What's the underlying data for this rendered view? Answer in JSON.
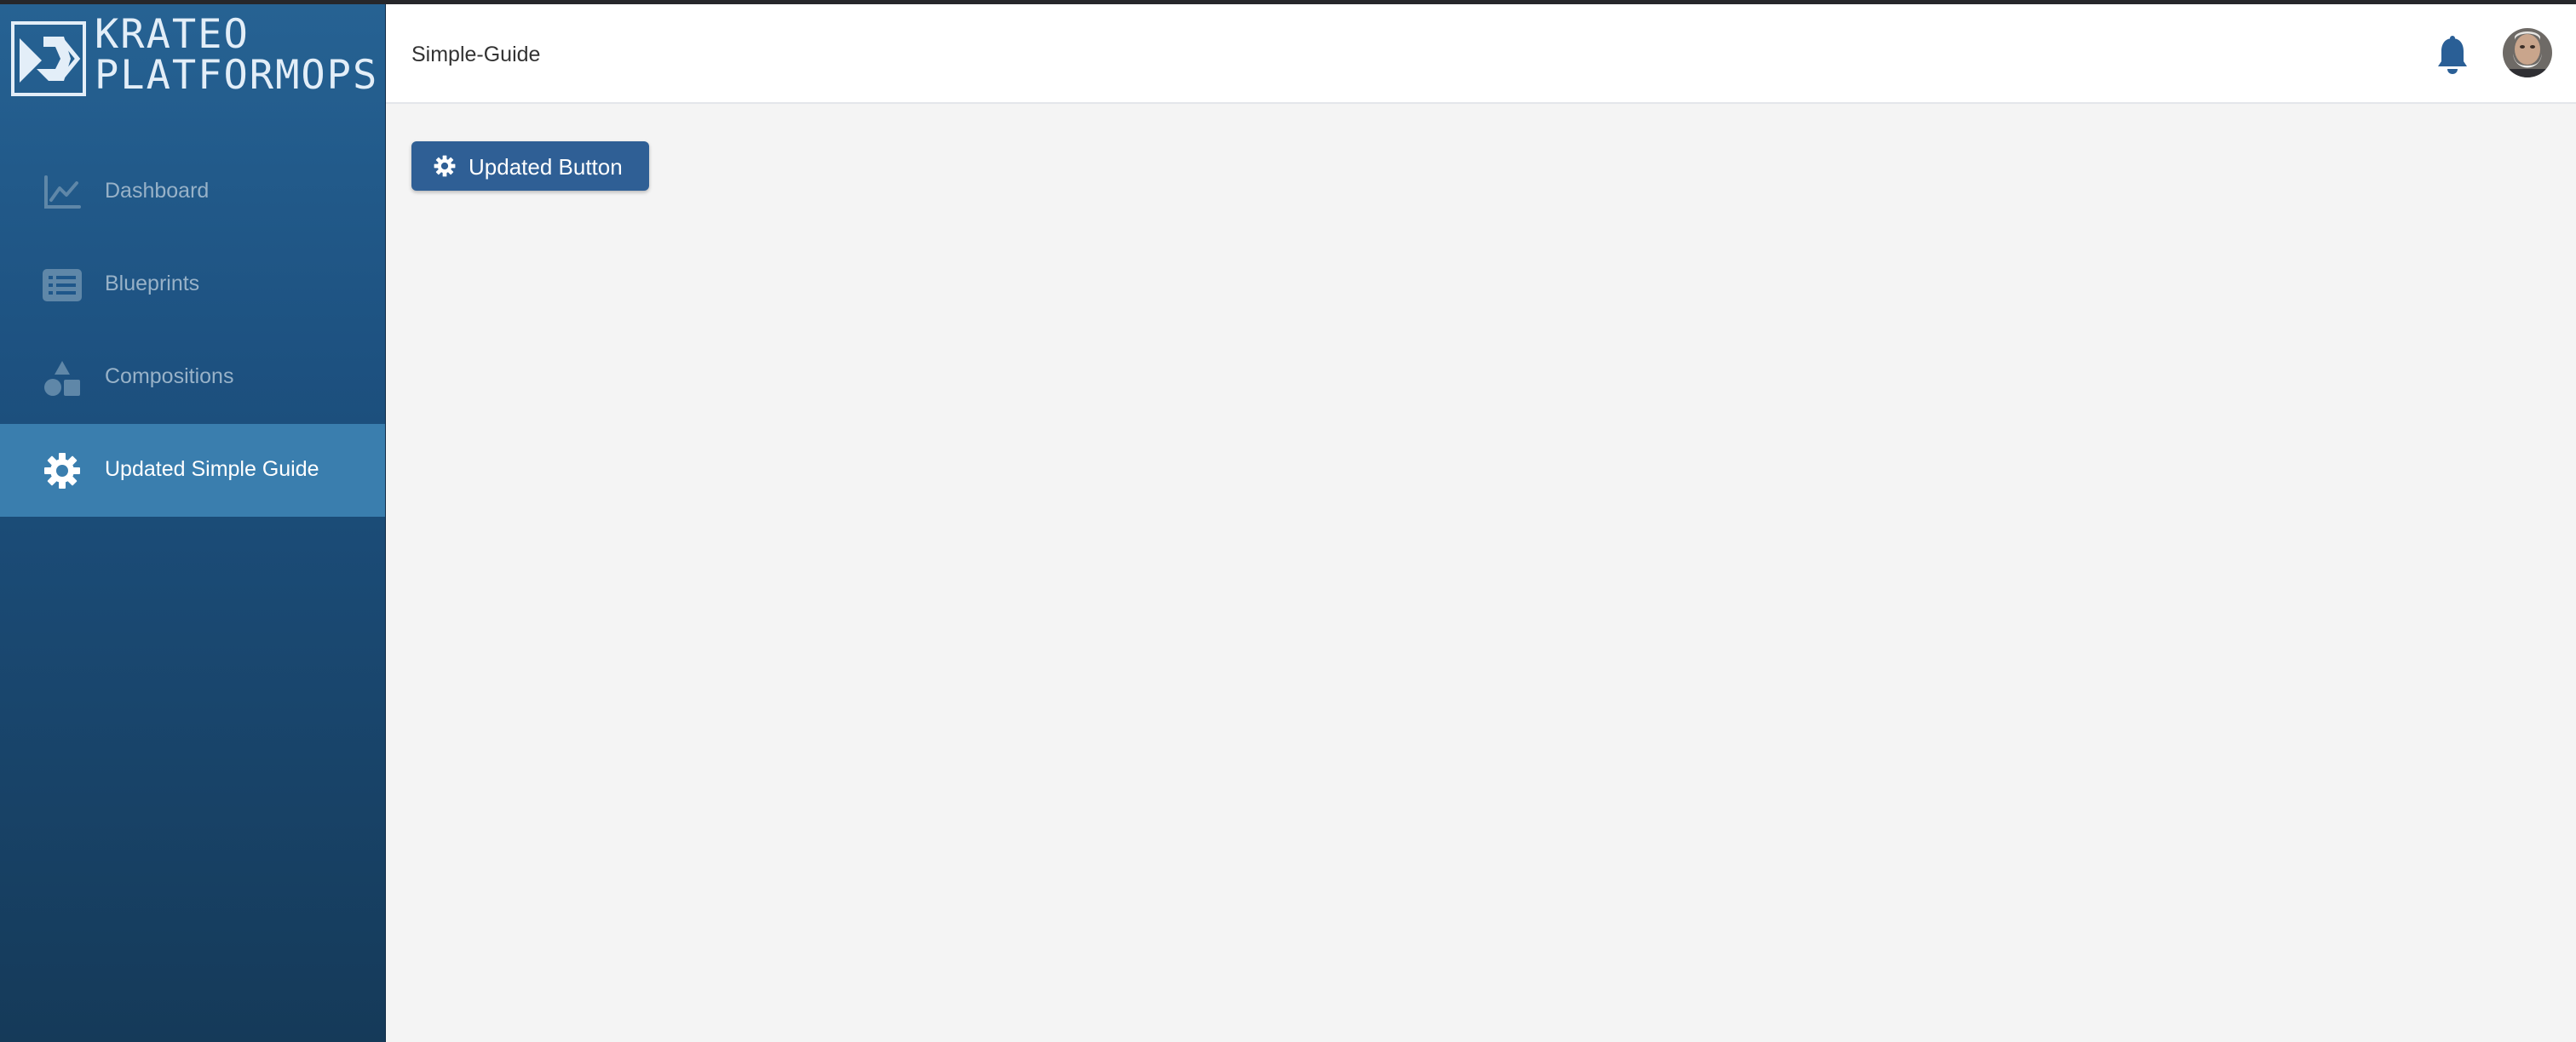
{
  "brand": {
    "line1": "KRATEO",
    "line2": "PLATFORMOPS"
  },
  "sidebar": {
    "items": [
      {
        "label": "Dashboard",
        "icon": "line-chart-icon",
        "active": false
      },
      {
        "label": "Blueprints",
        "icon": "list-icon",
        "active": false
      },
      {
        "label": "Compositions",
        "icon": "shapes-icon",
        "active": false
      },
      {
        "label": "Updated Simple Guide",
        "icon": "gear-icon",
        "active": true
      }
    ]
  },
  "header": {
    "title": "Simple-Guide",
    "notification_icon": "bell-icon",
    "avatar_icon": "user-avatar"
  },
  "main": {
    "button_label": "Updated Button",
    "button_icon": "gear-icon"
  },
  "colors": {
    "sidebar_top": "#266293",
    "sidebar_bottom": "#153a59",
    "active_item": "#3a7eae",
    "accent": "#2f5f95",
    "bell": "#2a5f96"
  }
}
